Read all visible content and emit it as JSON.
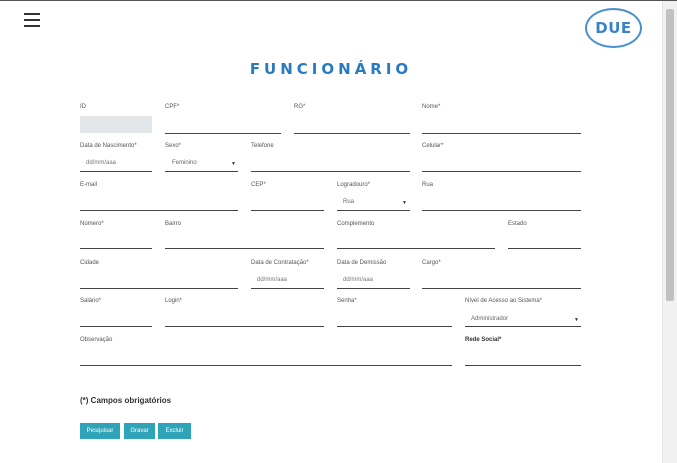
{
  "header": {
    "logo_text": "DUE",
    "title": "FUNCIONÁRIO"
  },
  "form": {
    "id_label": "ID",
    "cpf_label": "CPF*",
    "rg_label": "RG*",
    "nome_label": "Nome*",
    "nascimento_label": "Data de Nascimento*",
    "nascimento_placeholder": "dd/mm/aaa",
    "sexo_label": "Sexo*",
    "sexo_value": "Feminino",
    "telefone_label": "Telefone",
    "celular_label": "Celular*",
    "email_label": "E-mail",
    "cep_label": "CEP*",
    "logradouro_label": "Logradouro*",
    "logradouro_value": "Rua",
    "rua_label": "Rua",
    "numero_label": "Número*",
    "bairro_label": "Bairro",
    "complemento_label": "Complemento",
    "estado_label": "Estado",
    "cidade_label": "Cidade",
    "contratacao_label": "Data de Contratação*",
    "contratacao_placeholder": "dd/mm/aaa",
    "demissao_label": "Data de Demissão",
    "demissao_placeholder": "dd/mm/aaa",
    "cargo_label": "Cargo*",
    "salario_label": "Salário*",
    "login_label": "Login*",
    "senha_label": "Senha*",
    "nivel_label": "Nível de Acesso ao Sistema*",
    "nivel_value": "Administrador",
    "observacao_label": "Observação",
    "rede_social_label": "Rede Social*",
    "required_note": "(*) Campos obrigatórios"
  },
  "buttons": {
    "pesquisar": "Pesquisar",
    "gravar": "Gravar",
    "excluir": "Excluir"
  },
  "colors": {
    "accent": "#2a7abf",
    "button": "#2fa3b7",
    "logo_border": "#4a8fd0"
  }
}
